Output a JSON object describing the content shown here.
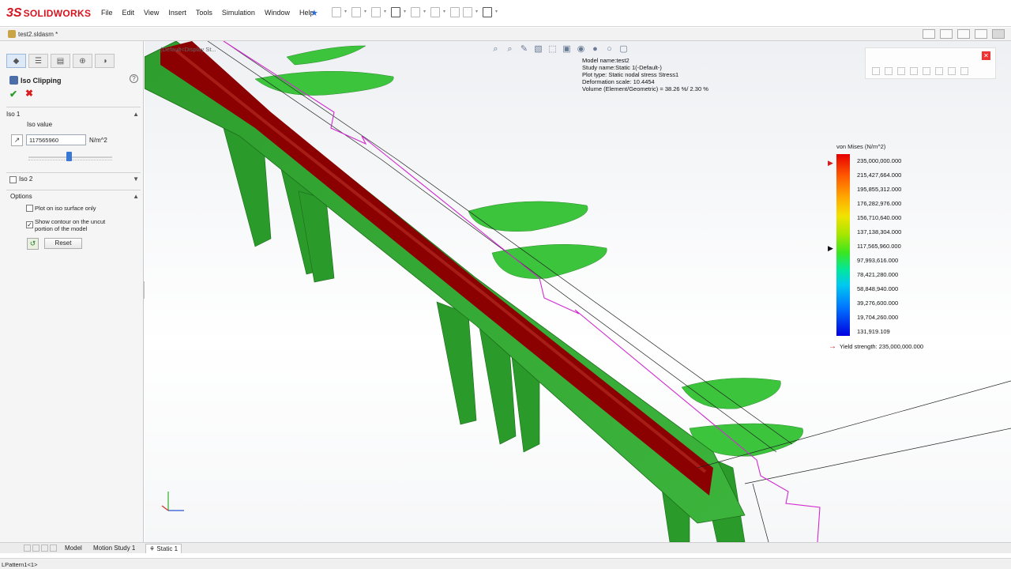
{
  "app": {
    "brand": "SOLIDWORKS",
    "brand_prefix": "3S",
    "brand_color": "#d4141f"
  },
  "menu": {
    "items": [
      "File",
      "Edit",
      "View",
      "Insert",
      "Tools",
      "Simulation",
      "Window",
      "Help"
    ]
  },
  "document": {
    "title": "test2.sldasm *"
  },
  "panel": {
    "title": "Iso Clipping",
    "ok_icon": "check-icon",
    "cancel_icon": "close-icon",
    "iso1": {
      "header": "Iso 1",
      "iso_value_label": "Iso value",
      "iso_value": "117565960",
      "unit": "N/m^2",
      "slider_fraction": 0.5
    },
    "iso2": {
      "header": "Iso 2",
      "checked": false
    },
    "options": {
      "header": "Options",
      "plot_iso_only": "Plot on iso surface only",
      "plot_iso_only_checked": false,
      "show_contour_line1": "Show contour on the uncut",
      "show_contour_line2": "portion of the model",
      "show_contour_checked": true,
      "reset_label": "Reset"
    }
  },
  "viewport": {
    "tree_hint": "(Default<Display St...",
    "info": {
      "model_name": "Model name:test2",
      "study_name": "Study name:Static 1(-Default-)",
      "plot_type": "Plot type: Static nodal stress Stress1",
      "deformation_scale": "Deformation scale: 10.4454",
      "volume": "Volume (Element/Geometric) = 38.26 %/ 2.30 %"
    },
    "legend": {
      "title": "von Mises (N/m^2)",
      "values": [
        "235,000,000.000",
        "215,427,664.000",
        "195,855,312.000",
        "176,282,976.000",
        "156,710,640.000",
        "137,138,304.000",
        "117,565,960.000",
        "97,993,616.000",
        "78,421,280.000",
        "58,848,940.000",
        "39,276,600.000",
        "19,704,260.000",
        "131,919.109"
      ],
      "yield_label": "Yield strength: 235,000,000.000"
    },
    "colors": {
      "stress_high": "#8b0000",
      "stress_mid": "#2aa82a",
      "outline": "#d02ad0",
      "yield_arrow": "#d41c1c"
    }
  },
  "bottom_tabs": {
    "model": "Model",
    "motion": "Motion Study 1",
    "static": "Static 1"
  },
  "status": {
    "text": "LPattern1<1>"
  }
}
